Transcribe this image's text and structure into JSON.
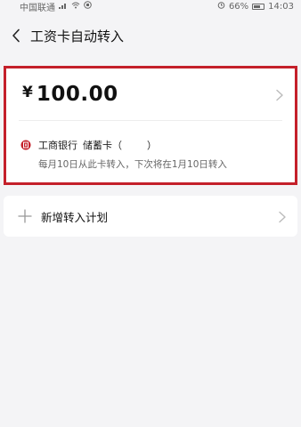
{
  "status_bar": {
    "carrier": "中国联通",
    "battery_percent": "66%",
    "battery_level": 0.66,
    "time": "14:03"
  },
  "header": {
    "title": "工资卡自动转入"
  },
  "transfer_card": {
    "currency_symbol": "¥",
    "amount": "100.00",
    "bank_name": "工商银行",
    "card_type": "储蓄卡（",
    "card_suffix": "）",
    "schedule": "每月10日从此卡转入，下次将在1月10日转入"
  },
  "add_plan": {
    "label": "新增转入计划"
  },
  "colors": {
    "highlight_border": "#c4202a",
    "bank_logo": "#c4202a",
    "background": "#f4f4f6"
  },
  "icons": {
    "back": "chevron-left-icon",
    "chevron": "chevron-right-icon",
    "bank": "icbc-logo-icon",
    "add": "plus-icon"
  }
}
